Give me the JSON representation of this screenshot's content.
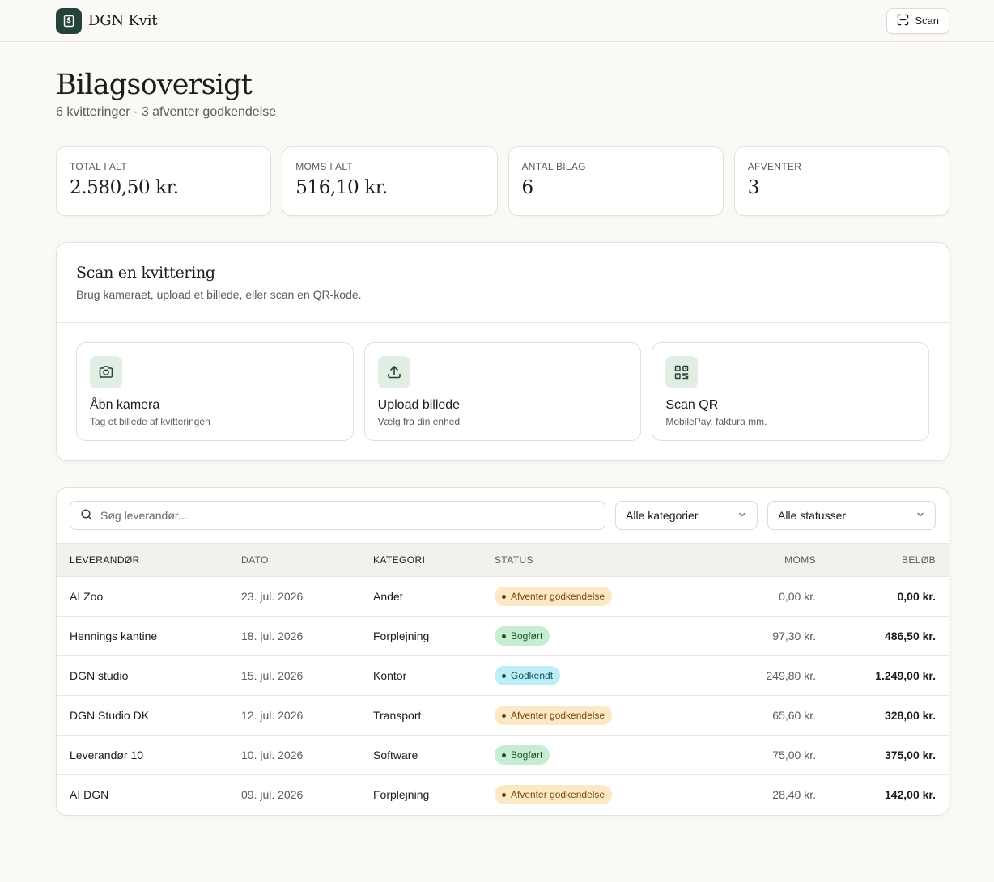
{
  "header": {
    "brand_name": "DGN Kvit",
    "brand_icon": "receipt-dollar-icon",
    "scan_label": "Scan"
  },
  "page": {
    "title": "Bilagsoversigt",
    "subtitle": "6 kvitteringer · 3 afventer godkendelse"
  },
  "stats": [
    {
      "label": "TOTAL I ALT",
      "value": "2.580,50 kr."
    },
    {
      "label": "MOMS I ALT",
      "value": "516,10 kr."
    },
    {
      "label": "ANTAL BILAG",
      "value": "6"
    },
    {
      "label": "AFVENTER",
      "value": "3"
    }
  ],
  "scan_card": {
    "title": "Scan en kvittering",
    "description": "Brug kameraet, upload et billede, eller scan en QR-kode.",
    "options": [
      {
        "title": "Åbn kamera",
        "description": "Tag et billede af kvitteringen",
        "icon": "camera-icon"
      },
      {
        "title": "Upload billede",
        "description": "Vælg fra din enhed",
        "icon": "upload-icon"
      },
      {
        "title": "Scan QR",
        "description": "MobilePay, faktura mm.",
        "icon": "qr-code-icon"
      }
    ]
  },
  "filters": {
    "search_placeholder": "Søg leverandør...",
    "category_selected": "Alle kategorier",
    "status_selected": "Alle statusser"
  },
  "table": {
    "columns": [
      "LEVERANDØR",
      "DATO",
      "KATEGORI",
      "STATUS",
      "MOMS",
      "BELØB"
    ],
    "rows": [
      {
        "vendor": "AI Zoo",
        "date": "23. jul. 2026",
        "category": "Andet",
        "status": "Afventer godkendelse",
        "status_kind": "pending",
        "moms": "0,00 kr.",
        "amount": "0,00 kr."
      },
      {
        "vendor": "Hennings kantine",
        "date": "18. jul. 2026",
        "category": "Forplejning",
        "status": "Bogført",
        "status_kind": "booked",
        "moms": "97,30 kr.",
        "amount": "486,50 kr."
      },
      {
        "vendor": "DGN studio",
        "date": "15. jul. 2026",
        "category": "Kontor",
        "status": "Godkendt",
        "status_kind": "approved",
        "moms": "249,80 kr.",
        "amount": "1.249,00 kr."
      },
      {
        "vendor": "DGN Studio DK",
        "date": "12. jul. 2026",
        "category": "Transport",
        "status": "Afventer godkendelse",
        "status_kind": "pending",
        "moms": "65,60 kr.",
        "amount": "328,00 kr."
      },
      {
        "vendor": "Leverandør 10",
        "date": "10. jul. 2026",
        "category": "Software",
        "status": "Bogført",
        "status_kind": "booked",
        "moms": "75,00 kr.",
        "amount": "375,00 kr."
      },
      {
        "vendor": "AI DGN",
        "date": "09. jul. 2026",
        "category": "Forplejning",
        "status": "Afventer godkendelse",
        "status_kind": "pending",
        "moms": "28,40 kr.",
        "amount": "142,00 kr."
      }
    ]
  },
  "status_colors": {
    "pending": {
      "bg": "#fbe9c6",
      "fg": "#7a4a0c",
      "dot": "#6b430c"
    },
    "booked": {
      "bg": "#c8ecd2",
      "fg": "#17552f",
      "dot": "#17552f"
    },
    "approved": {
      "bg": "#bdeef5",
      "fg": "#0e5560",
      "dot": "#0e5560"
    }
  },
  "colors": {
    "brand": "#24443a",
    "icon_tile": "#e2ede3",
    "background": "#faf9f6"
  }
}
